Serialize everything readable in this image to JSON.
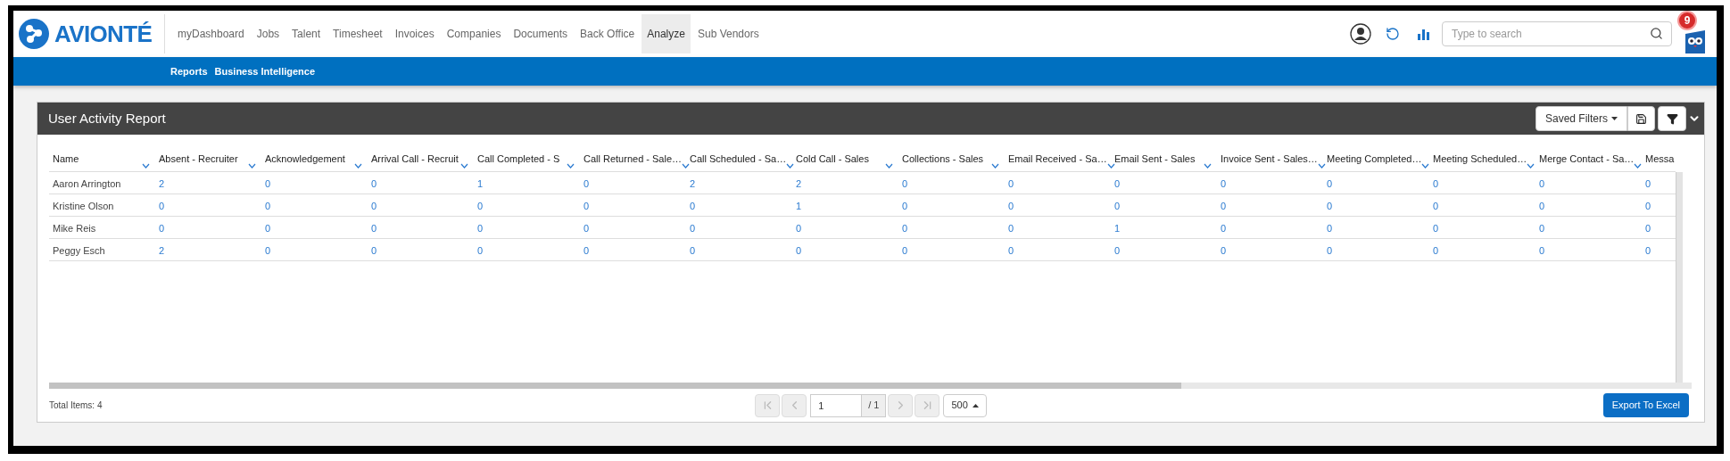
{
  "app": {
    "logo_text": "AVIONTÉ",
    "notification_count": "9"
  },
  "nav": [
    {
      "label": "myDashboard",
      "selected": false
    },
    {
      "label": "Jobs",
      "selected": false
    },
    {
      "label": "Talent",
      "selected": false
    },
    {
      "label": "Timesheet",
      "selected": false
    },
    {
      "label": "Invoices",
      "selected": false
    },
    {
      "label": "Companies",
      "selected": false
    },
    {
      "label": "Documents",
      "selected": false
    },
    {
      "label": "Back Office",
      "selected": false
    },
    {
      "label": "Analyze",
      "selected": true
    },
    {
      "label": "Sub Vendors",
      "selected": false
    }
  ],
  "subnav": [
    {
      "label": "Reports"
    },
    {
      "label": "Business Intelligence"
    }
  ],
  "search": {
    "placeholder": "Type to search"
  },
  "report": {
    "title": "User Activity Report",
    "saved_filters": "Saved Filters"
  },
  "table": {
    "columns": [
      "Name",
      "Absent - Recruiter",
      "Acknowledgement",
      "Arrival Call - Recruit",
      "Call Completed - S",
      "Call Returned - Sale…",
      "Call Scheduled - Sa…",
      "Cold Call - Sales",
      "Collections - Sales",
      "Email Received - Sa…",
      "Email Sent - Sales",
      "Invoice Sent - Sales…",
      "Meeting Completed…",
      "Meeting Scheduled…",
      "Merge Contact - Sa…",
      "Messa"
    ],
    "rows": [
      {
        "name": "Aaron Arrington",
        "values": [
          "2",
          "0",
          "0",
          "1",
          "0",
          "2",
          "2",
          "0",
          "0",
          "0",
          "0",
          "0",
          "0",
          "0",
          "0"
        ]
      },
      {
        "name": "Kristine Olson",
        "values": [
          "0",
          "0",
          "0",
          "0",
          "0",
          "0",
          "1",
          "0",
          "0",
          "0",
          "0",
          "0",
          "0",
          "0",
          "0"
        ]
      },
      {
        "name": "Mike Reis",
        "values": [
          "0",
          "0",
          "0",
          "0",
          "0",
          "0",
          "0",
          "0",
          "0",
          "1",
          "0",
          "0",
          "0",
          "0",
          "0"
        ]
      },
      {
        "name": "Peggy Esch",
        "values": [
          "2",
          "0",
          "0",
          "0",
          "0",
          "0",
          "0",
          "0",
          "0",
          "0",
          "0",
          "0",
          "0",
          "0",
          "0"
        ]
      }
    ]
  },
  "pager": [
    {
      "kind": "first",
      "disabled": true
    },
    {
      "kind": "prev",
      "disabled": true
    },
    {
      "kind": "next",
      "disabled": true
    },
    {
      "kind": "last",
      "disabled": true
    }
  ],
  "footer": {
    "total": "Total Items: 4",
    "page": "1",
    "page_count": "/ 1",
    "page_size": "500",
    "export": "Export To Excel"
  }
}
